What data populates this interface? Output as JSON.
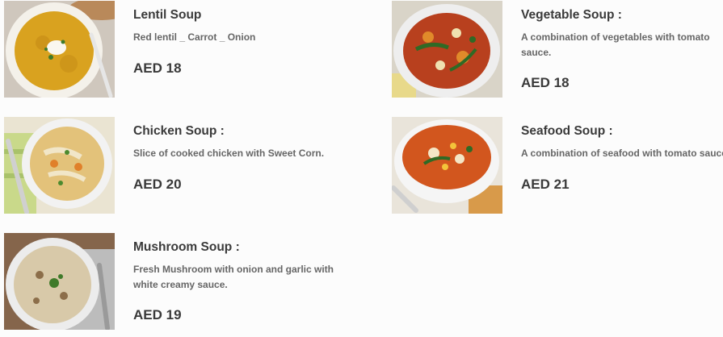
{
  "menu": {
    "items": [
      {
        "name": "Lentil Soup",
        "description": "Red lentil _ Carrot _ Onion",
        "price": "AED 18"
      },
      {
        "name": "Vegetable Soup :",
        "description": "A combination of vegetables with tomato sauce.",
        "price": "AED 18"
      },
      {
        "name": "Chicken Soup :",
        "description": "Slice of cooked chicken with Sweet Corn.",
        "price": "AED 20"
      },
      {
        "name": "Seafood Soup :",
        "description": "A combination of seafood with tomato sauce.",
        "price": "AED 21"
      },
      {
        "name": "Mushroom Soup :",
        "description": "Fresh Mushroom with onion and garlic with white creamy sauce.",
        "price": "AED 19"
      }
    ]
  }
}
